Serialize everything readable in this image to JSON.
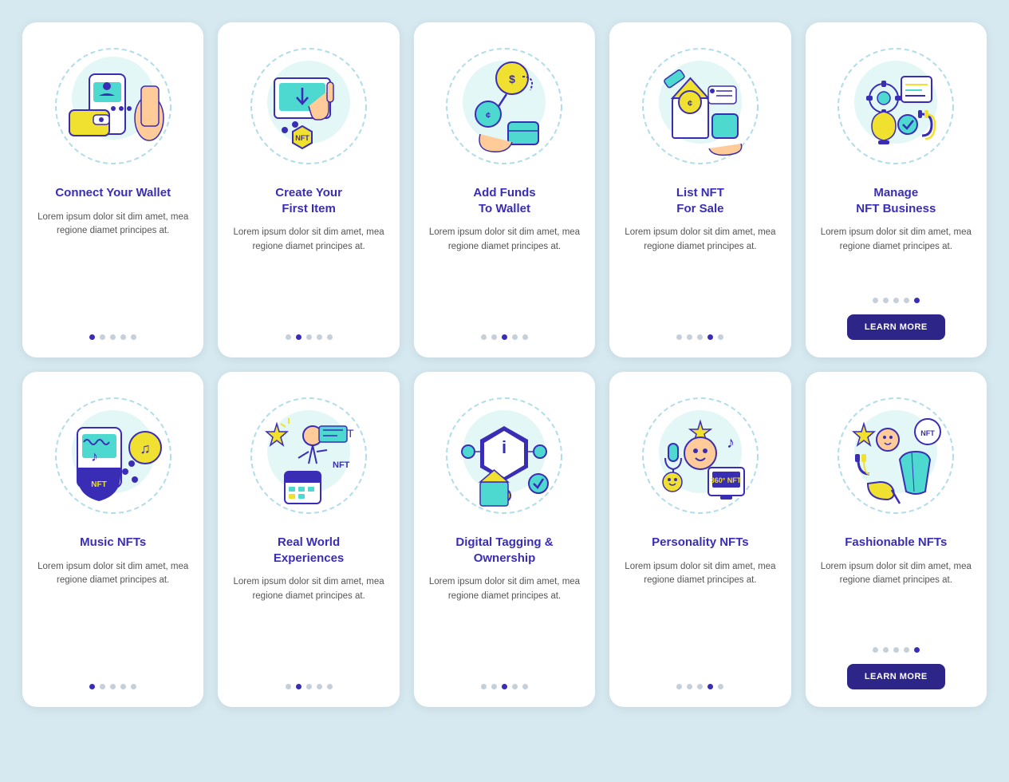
{
  "cards": [
    {
      "id": "connect-wallet",
      "title": "Connect Your\nWallet",
      "body": "Lorem ipsum dolor sit dim amet, mea regione diamet principes at.",
      "dots": [
        1,
        0,
        0,
        0,
        0
      ],
      "hasButton": false,
      "buttonLabel": ""
    },
    {
      "id": "create-first-item",
      "title": "Create Your\nFirst Item",
      "body": "Lorem ipsum dolor sit dim amet, mea regione diamet principes at.",
      "dots": [
        0,
        1,
        0,
        0,
        0
      ],
      "hasButton": false,
      "buttonLabel": ""
    },
    {
      "id": "add-funds",
      "title": "Add Funds\nTo Wallet",
      "body": "Lorem ipsum dolor sit dim amet, mea regione diamet principes at.",
      "dots": [
        0,
        0,
        1,
        0,
        0
      ],
      "hasButton": false,
      "buttonLabel": ""
    },
    {
      "id": "list-nft",
      "title": "List NFT\nFor Sale",
      "body": "Lorem ipsum dolor sit dim amet, mea regione diamet principes at.",
      "dots": [
        0,
        0,
        0,
        1,
        0
      ],
      "hasButton": false,
      "buttonLabel": ""
    },
    {
      "id": "manage-nft",
      "title": "Manage\nNFT Business",
      "body": "Lorem ipsum dolor sit dim amet, mea regione diamet principes at.",
      "dots": [
        0,
        0,
        0,
        0,
        1
      ],
      "hasButton": true,
      "buttonLabel": "LEARN MORE"
    },
    {
      "id": "music-nft",
      "title": "Music NFTs",
      "body": "Lorem ipsum dolor sit dim amet, mea regione diamet principes at.",
      "dots": [
        1,
        0,
        0,
        0,
        0
      ],
      "hasButton": false,
      "buttonLabel": ""
    },
    {
      "id": "real-world",
      "title": "Real World\nExperiences",
      "body": "Lorem ipsum dolor sit dim amet, mea regione diamet principes at.",
      "dots": [
        0,
        1,
        0,
        0,
        0
      ],
      "hasButton": false,
      "buttonLabel": ""
    },
    {
      "id": "digital-tagging",
      "title": "Digital Tagging &\nOwnership",
      "body": "Lorem ipsum dolor sit dim amet, mea regione diamet principes at.",
      "dots": [
        0,
        0,
        1,
        0,
        0
      ],
      "hasButton": false,
      "buttonLabel": ""
    },
    {
      "id": "personality-nft",
      "title": "Personality NFTs",
      "body": "Lorem ipsum dolor sit dim amet, mea regione diamet principes at.",
      "dots": [
        0,
        0,
        0,
        1,
        0
      ],
      "hasButton": false,
      "buttonLabel": ""
    },
    {
      "id": "fashionable-nft",
      "title": "Fashionable NFTs",
      "body": "Lorem ipsum dolor sit dim amet, mea regione diamet principes at.",
      "dots": [
        0,
        0,
        0,
        0,
        1
      ],
      "hasButton": true,
      "buttonLabel": "LEARN MORE"
    }
  ],
  "lorem": "Lorem ipsum dolor sit dim amet, mea regione diamet principes at."
}
